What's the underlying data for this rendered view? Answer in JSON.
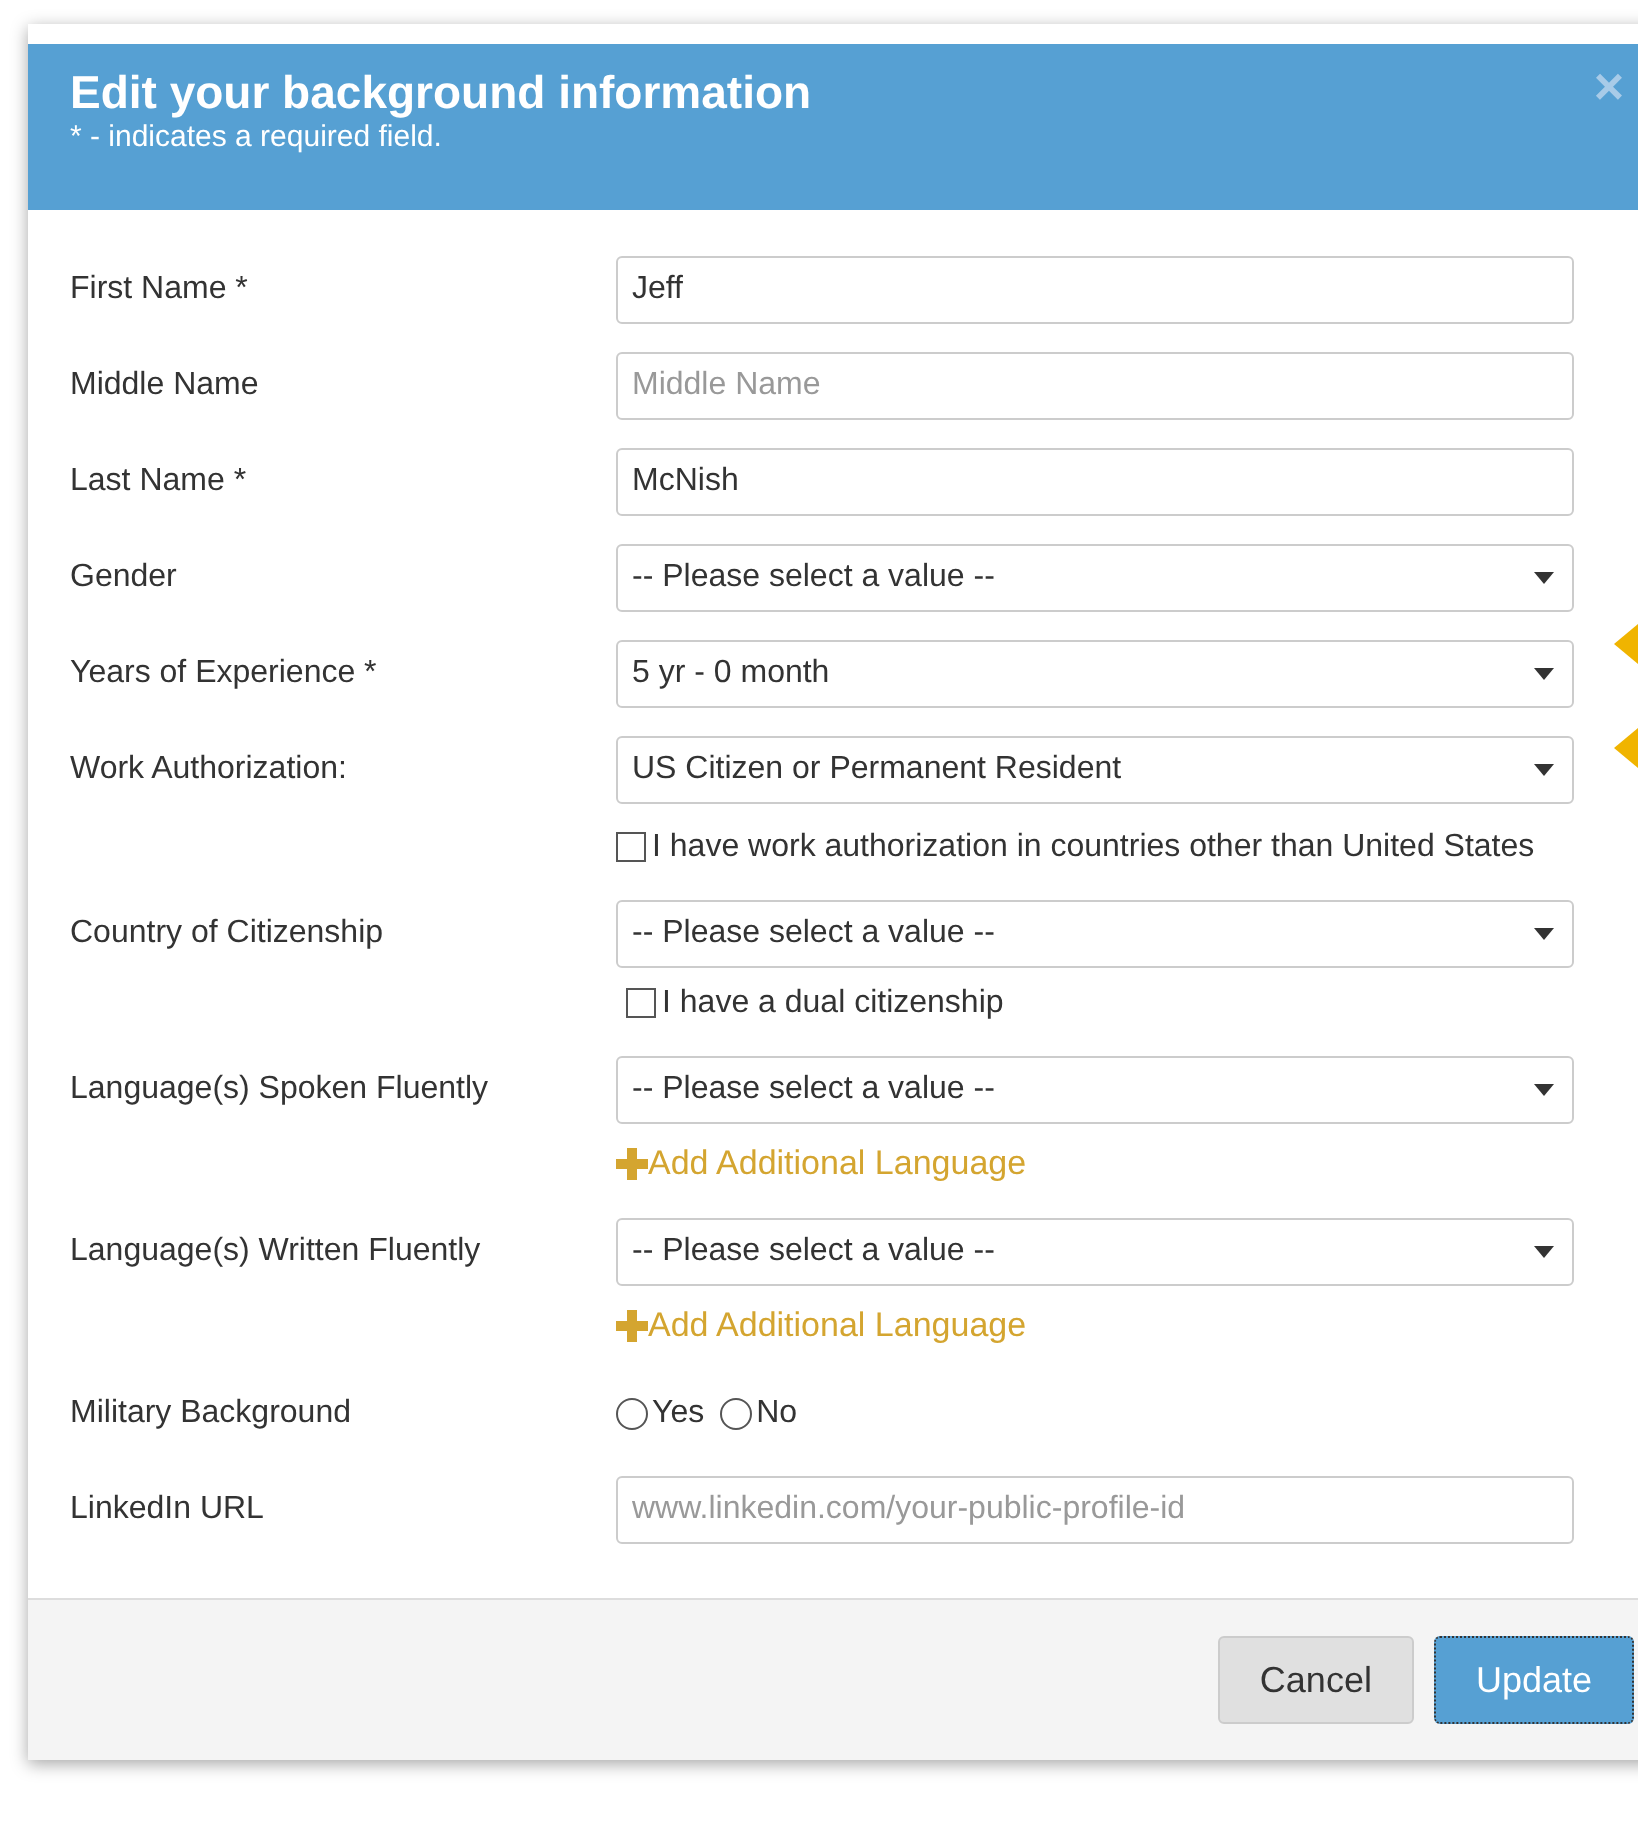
{
  "dialog": {
    "title": "Edit your background information",
    "subtitle": "* - indicates a required field.",
    "close": "×"
  },
  "fields": [
    {
      "label": "First Name *",
      "kind": "text",
      "value": "Jeff"
    },
    {
      "label": "Middle Name",
      "kind": "text",
      "placeholder": "Middle Name"
    },
    {
      "label": "Last Name *",
      "kind": "text",
      "value": "McNish"
    },
    {
      "label": "Gender",
      "kind": "select",
      "value": "-- Please select a value --"
    },
    {
      "label": "Years of Experience *",
      "kind": "select",
      "value": "5 yr - 0 month"
    },
    {
      "label": "Work Authorization:",
      "kind": "select",
      "value": "US Citizen or Permanent Resident",
      "checkbox": {
        "label": "I have work authorization in countries other than United States",
        "checked": false
      }
    },
    {
      "label": "Country of Citizenship",
      "kind": "select",
      "value": "-- Please select a value --",
      "checkbox": {
        "label": "I have a dual citizenship",
        "checked": false
      }
    },
    {
      "label": "Language(s) Spoken Fluently",
      "kind": "select",
      "value": "-- Please select a value --",
      "add_link": "Add Additional Language"
    },
    {
      "label": "Language(s) Written Fluently",
      "kind": "select",
      "value": "-- Please select a value --",
      "add_link": "Add Additional Language"
    },
    {
      "label": "Military Background",
      "kind": "radio",
      "options": [
        {
          "label": "Yes",
          "selected": false
        },
        {
          "label": "No",
          "selected": false
        }
      ]
    },
    {
      "label": "LinkedIn URL",
      "kind": "text",
      "placeholder": "www.linkedin.com/your-public-profile-id"
    }
  ],
  "buttons": [
    {
      "label": "Cancel",
      "kind": "secondary"
    },
    {
      "label": "Update",
      "kind": "primary"
    }
  ]
}
